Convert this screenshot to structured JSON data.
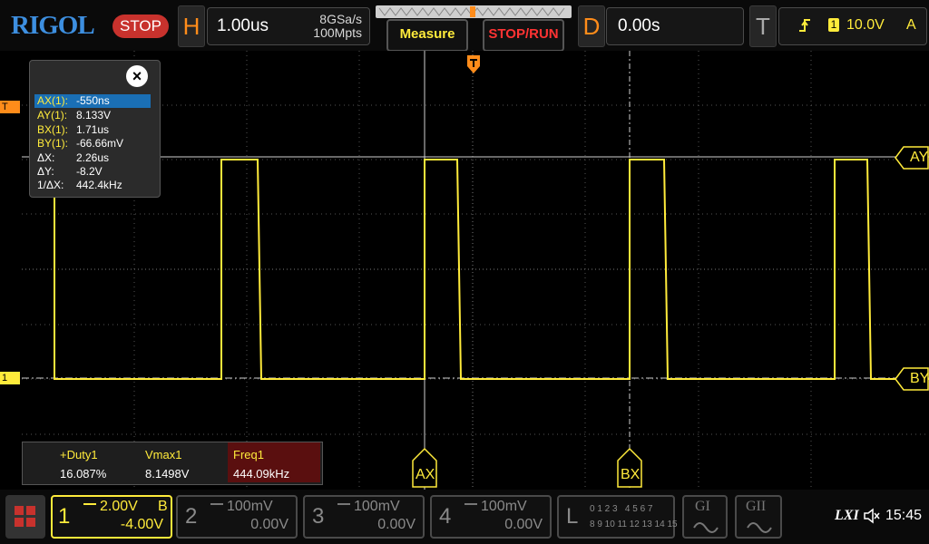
{
  "top": {
    "logo": "RIGOL",
    "run_state": "STOP",
    "horizontal": {
      "letter": "H",
      "timebase": "1.00us",
      "sample_rate": "8GSa/s",
      "memory_depth": "100Mpts"
    },
    "measure_label": "Measure",
    "stop_run_label": "STOP/RUN",
    "delay": {
      "letter": "D",
      "value": "0.00s"
    },
    "trigger": {
      "letter": "T",
      "source": "1",
      "level": "10.0V",
      "mode": "A"
    }
  },
  "markers": {
    "trigger_level": "T",
    "channel1_ground": "1"
  },
  "cursor_info": {
    "rows": [
      {
        "key": "AX(1):",
        "value": "-550ns"
      },
      {
        "key": "AY(1):",
        "value": "8.133V"
      },
      {
        "key": "BX(1):",
        "value": "1.71us"
      },
      {
        "key": "BY(1):",
        "value": "-66.66mV"
      },
      {
        "key": "ΔX:",
        "value": "2.26us"
      },
      {
        "key": "ΔY:",
        "value": "-8.2V"
      },
      {
        "key": "1/ΔX:",
        "value": "442.4kHz"
      }
    ],
    "close": "×"
  },
  "cursor_labels": {
    "ay": "AY",
    "by": "BY",
    "ax": "AX",
    "bx": "BX"
  },
  "measurements": {
    "duty": {
      "label": "+Duty1",
      "value": "16.087%"
    },
    "vmax": {
      "label": "Vmax1",
      "value": "8.1498V"
    },
    "freq": {
      "label": "Freq1",
      "value": "444.09kHz"
    }
  },
  "channels": {
    "ch1": {
      "num": "1",
      "scale": "2.00V",
      "bw": "B",
      "offset": "-4.00V"
    },
    "ch2": {
      "num": "2",
      "scale": "100mV",
      "offset": "0.00V"
    },
    "ch3": {
      "num": "3",
      "scale": "100mV",
      "offset": "0.00V"
    },
    "ch4": {
      "num": "4",
      "scale": "100mV",
      "offset": "0.00V"
    }
  },
  "logic": {
    "letter": "L",
    "row1": "0 1 2 3   4 5 6 7",
    "row2": "8 9 10 11 12 13 14 15"
  },
  "gen": {
    "g1": "GI",
    "g2": "GII"
  },
  "status": {
    "lxi": "LXI",
    "time": "15:45"
  },
  "colors": {
    "ch1": "#ffeb3b",
    "accent": "#ff8c1a",
    "grid": "#505050",
    "stop": "#c8322d",
    "freq_bg": "#5a0f0f"
  }
}
